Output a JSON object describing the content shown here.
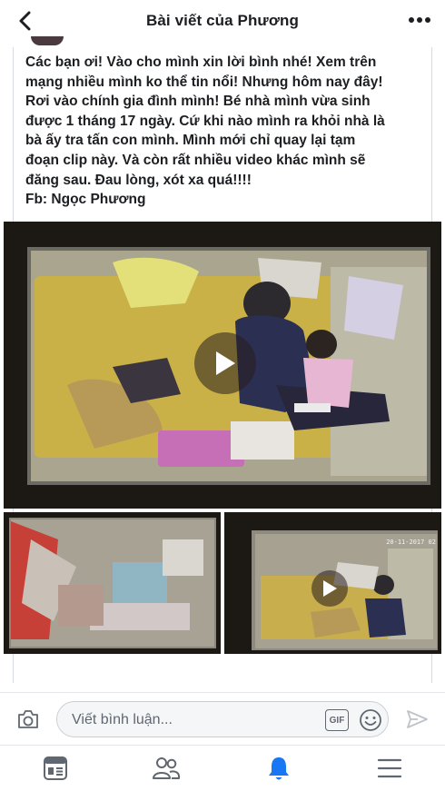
{
  "header": {
    "title": "Bài viết của Phương",
    "back_icon": "chevron-left-icon",
    "more_icon": "more-horizontal-icon"
  },
  "post": {
    "text": "Các bạn ơi! Vào cho mình xin lời bình nhé! Xem trên\nmạng nhiều mình ko thể tin nổi! Nhưng hôm nay đây!\nRơi vào chính gia đình mình! Bé nhà mình vừa sinh\nđược 1 tháng 17 ngày. Cứ khi nào mình ra khỏi nhà là\nbà ấy tra tấn con mình. Mình mới chỉ quay lại tạm\nđoạn clip này. Và còn rất nhiều video khác mình sẽ\nđăng sau. Đau lòng, xót xa quá!!!!\nFb: Ngọc Phương"
  },
  "media": {
    "main_video": {
      "play_icon": "play-icon"
    },
    "thumb_left": {},
    "thumb_right": {
      "timestamp": "20-11-2017 02",
      "play_icon": "play-icon"
    }
  },
  "comment_bar": {
    "placeholder": "Viết bình luận...",
    "gif_label": "GIF",
    "camera_icon": "camera-icon",
    "emoji_icon": "smiley-icon",
    "send_icon": "send-icon"
  },
  "tab_bar": {
    "tabs": [
      {
        "name": "news-feed",
        "icon": "news-feed-icon",
        "active": false
      },
      {
        "name": "friends",
        "icon": "friends-icon",
        "active": false
      },
      {
        "name": "notifications",
        "icon": "bell-icon",
        "active": true
      },
      {
        "name": "menu",
        "icon": "hamburger-menu-icon",
        "active": false
      }
    ]
  },
  "colors": {
    "accent": "#1877f2",
    "icon_gray": "#606770",
    "text": "#1c1e21"
  }
}
